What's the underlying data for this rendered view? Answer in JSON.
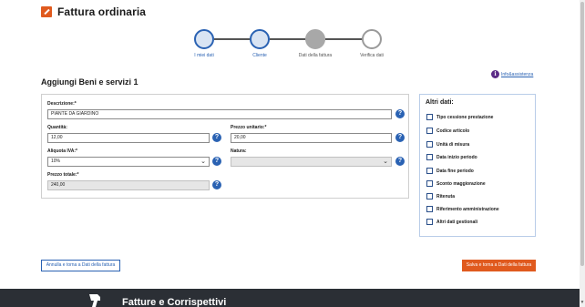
{
  "header": {
    "title": "Fattura ordinaria",
    "icon": "edit-icon"
  },
  "stepper": {
    "steps": [
      {
        "label": "I miei dati",
        "state": "done"
      },
      {
        "label": "Cliente",
        "state": "done"
      },
      {
        "label": "Dati della fattura",
        "state": "current"
      },
      {
        "label": "Verifica dati",
        "state": "todo"
      }
    ]
  },
  "help_link": {
    "label": "Info&assistenza"
  },
  "section": {
    "title": "Aggiungi Beni e servizi 1"
  },
  "form": {
    "descrizione": {
      "label": "Descrizione:*",
      "value": "PIANTE DA GIARDINO"
    },
    "quantita": {
      "label": "Quantità:",
      "value": "12,00"
    },
    "prezzo_unitario": {
      "label": "Prezzo unitario:*",
      "value": "20,00"
    },
    "aliquota": {
      "label": "Aliquota IVA:*",
      "value": "10%"
    },
    "natura": {
      "label": "Natura:",
      "value": ""
    },
    "prezzo_totale": {
      "label": "Prezzo totale:*",
      "value": "240,00"
    },
    "help_glyph": "?",
    "chevron_glyph": "⌄"
  },
  "altri_dati": {
    "title": "Altri dati:",
    "items": [
      "Tipo cessione prestazione",
      "Codice articolo",
      "Unità di misura",
      "Data inizio periodo",
      "Data fine periodo",
      "Sconto maggiorazione",
      "Ritenuta",
      "Riferimento amministrazione",
      "Altri dati gestionali"
    ]
  },
  "buttons": {
    "back": "Annulla e torna a Dati della fattura",
    "save": "Salva e torna a Dati della fattura"
  },
  "footer": {
    "title": "Fatture e Corrispettivi"
  },
  "colors": {
    "accent": "#e05a1e",
    "primary": "#2a62b3",
    "footer_bg": "#2b2f35"
  }
}
